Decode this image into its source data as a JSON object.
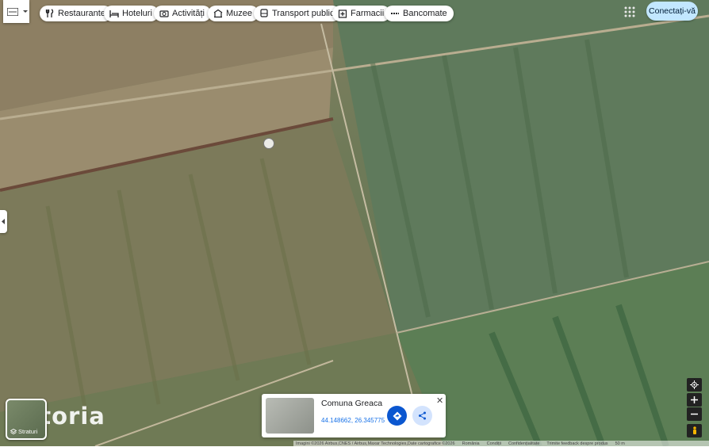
{
  "categories": [
    {
      "label": "Restaurante",
      "icon": "fork-knife-icon"
    },
    {
      "label": "Hoteluri",
      "icon": "bed-icon"
    },
    {
      "label": "Activități",
      "icon": "camera-icon"
    },
    {
      "label": "Muzee",
      "icon": "museum-icon"
    },
    {
      "label": "Transport public",
      "icon": "bus-icon"
    },
    {
      "label": "Farmacii",
      "icon": "pharmacy-icon"
    },
    {
      "label": "Bancomate",
      "icon": "atm-icon"
    }
  ],
  "header": {
    "signin_label": "Conectați-vă"
  },
  "layers": {
    "label": "Straturi"
  },
  "watermark": "storia",
  "place_card": {
    "title": "Comuna Greaca",
    "coords": "44.148662, 26.345775"
  },
  "attribution": {
    "imagery": "Imagini ©2026 Airbus,CNES / Airbus,Maxar Technologies,Date cartografice ©2026",
    "country": "România",
    "terms": "Condiții",
    "privacy": "Confidențialitate",
    "feedback": "Trimite feedback despre produs",
    "scale": "50 m"
  },
  "colors": {
    "signin_bg": "#c2e7ff",
    "directions": "#0b57d0",
    "share_bg": "#d3e3fd"
  }
}
